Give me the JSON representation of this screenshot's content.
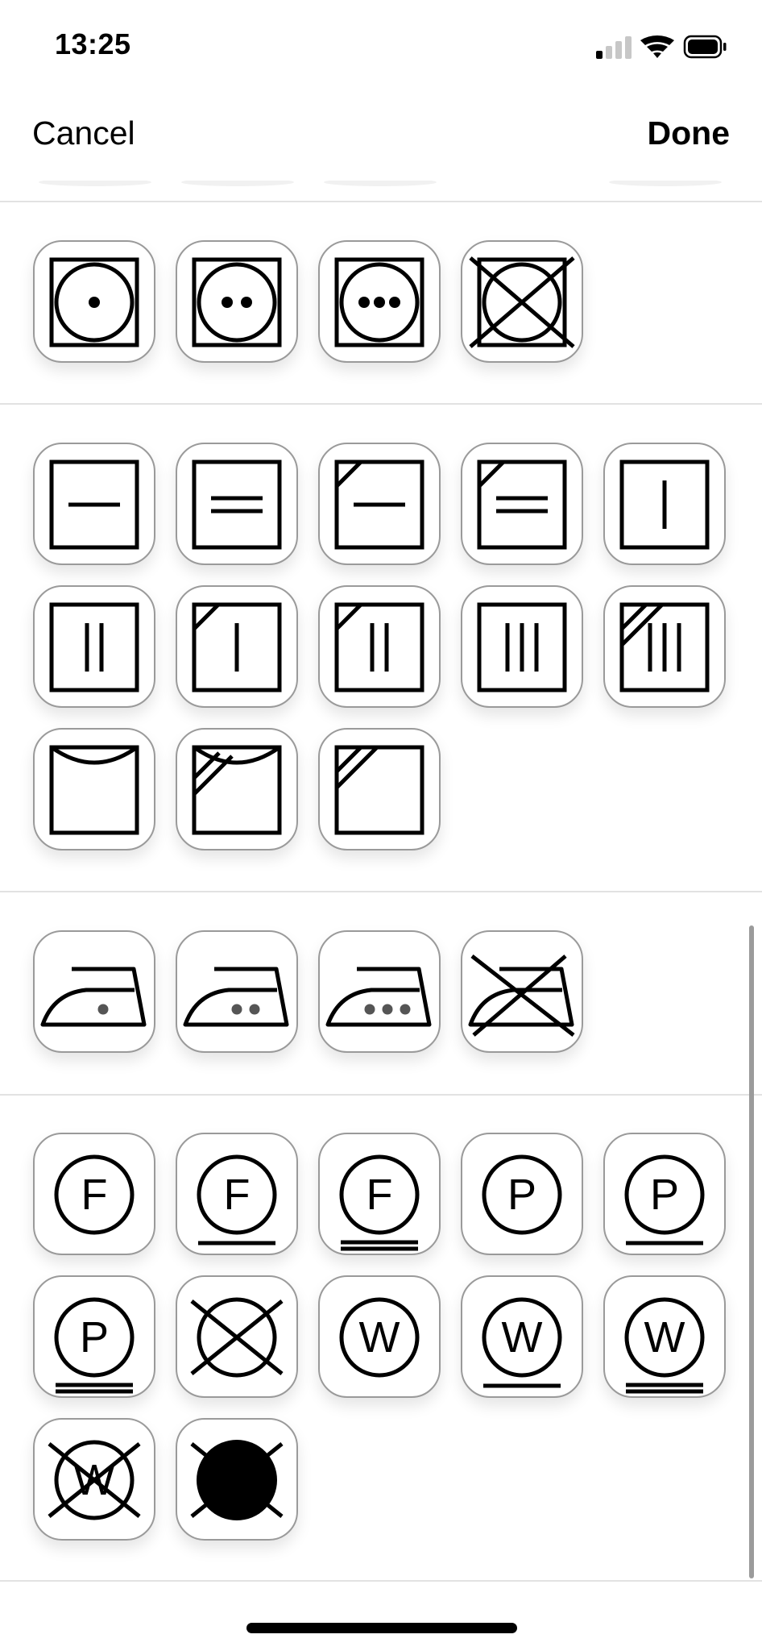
{
  "status_bar": {
    "time": "13:25"
  },
  "nav": {
    "cancel_label": "Cancel",
    "done_label": "Done"
  },
  "sections": [
    {
      "name": "tumble-drying",
      "symbols": [
        "tumble-dry-low-icon",
        "tumble-dry-medium-icon",
        "tumble-dry-high-icon",
        "do-not-tumble-dry-icon"
      ]
    },
    {
      "name": "natural-drying",
      "symbols": [
        "dry-flat-icon",
        "dry-flat-double-line-icon",
        "dry-flat-in-shade-icon",
        "dry-flat-in-shade-double-line-icon",
        "line-dry-vertical-icon",
        "drip-dry-icon",
        "drip-dry-shade-single-icon",
        "drip-dry-in-shade-icon",
        "three-vertical-lines-icon",
        "three-vertical-lines-shade-icon",
        "line-dry-icon",
        "line-dry-in-shade-icon",
        "dry-in-shade-icon"
      ]
    },
    {
      "name": "ironing",
      "symbols": [
        "iron-low-icon",
        "iron-medium-icon",
        "iron-high-icon",
        "do-not-iron-icon"
      ]
    },
    {
      "name": "professional-cleaning",
      "symbols": [
        "dry-clean-f-icon",
        "dry-clean-f-gentle-icon",
        "dry-clean-f-very-gentle-icon",
        "dry-clean-p-icon",
        "dry-clean-p-gentle-icon",
        "dry-clean-p-very-gentle-icon",
        "do-not-dry-clean-icon",
        "wet-clean-icon",
        "wet-clean-gentle-icon",
        "wet-clean-very-gentle-icon",
        "do-not-wet-clean-icon",
        "do-not-dry-clean-filled-icon"
      ]
    }
  ],
  "letters": {
    "f": "F",
    "p": "P",
    "w": "W"
  }
}
